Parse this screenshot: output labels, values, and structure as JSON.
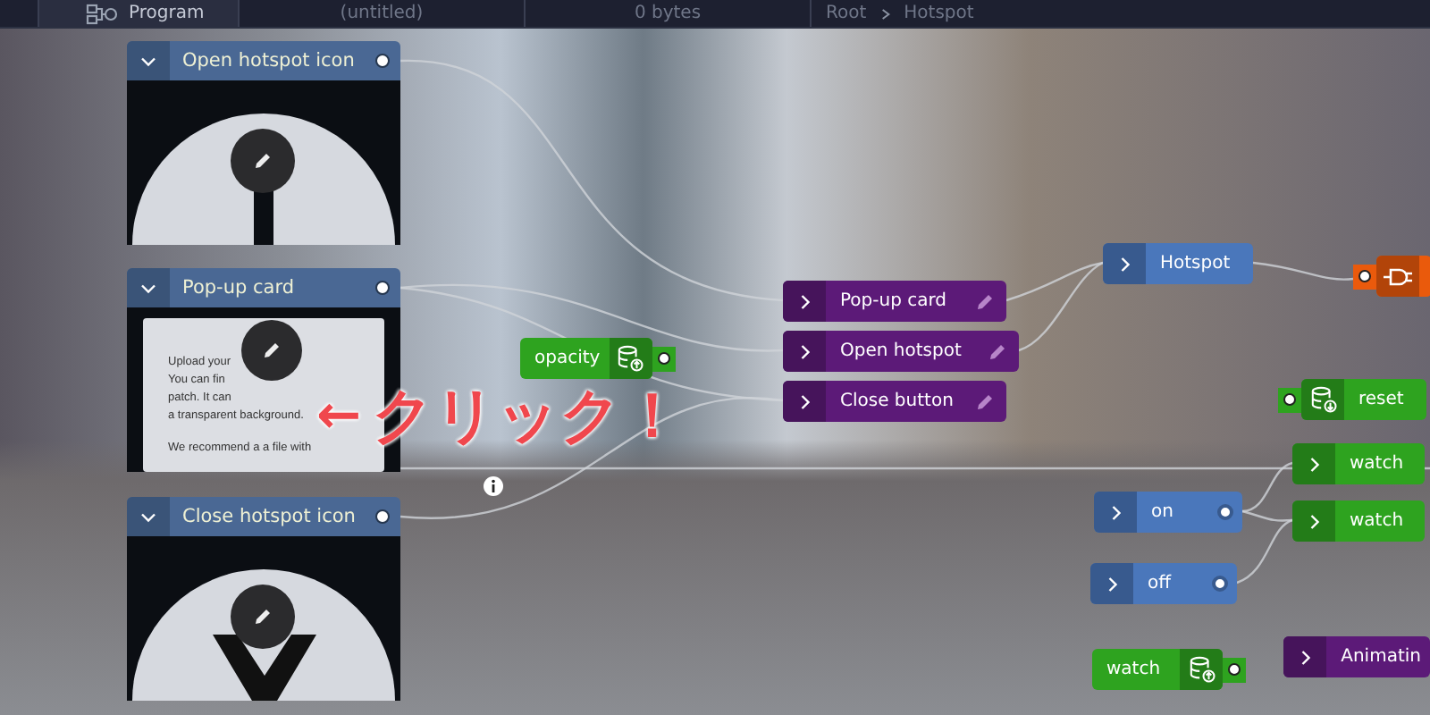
{
  "top_bar": {
    "program_label": "Program",
    "document_title": "(untitled)",
    "size": "0 bytes",
    "breadcrumb": [
      "Root",
      "Hotspot"
    ]
  },
  "image_nodes": [
    {
      "title": "Open hotspot icon",
      "kind": "open-icon"
    },
    {
      "title": "Pop-up card",
      "kind": "card",
      "card_paragraphs": [
        [
          "Upload your",
          "You can fin",
          "patch. It can",
          "a transparent background."
        ],
        [
          "We recommend a a file with"
        ]
      ]
    },
    {
      "title": "Close hotspot icon",
      "kind": "close-icon"
    }
  ],
  "nodes": [
    {
      "label": "opacity",
      "kind": "store-right",
      "color": "#2ea31f",
      "editable": false,
      "port": true
    },
    {
      "label": "Pop-up card",
      "kind": "chevron",
      "color": "#5c1a78",
      "editable": true,
      "port": false
    },
    {
      "label": "Open hotspot",
      "kind": "chevron",
      "color": "#5c1a78",
      "editable": true,
      "port": false
    },
    {
      "label": "Close button",
      "kind": "chevron",
      "color": "#5c1a78",
      "editable": true,
      "port": false
    },
    {
      "label": "Hotspot",
      "kind": "chevron",
      "color": "#4a77bb",
      "editable": false,
      "port": false
    },
    {
      "kind": "plug",
      "color": "#ea5a0c",
      "editable": false,
      "port": true
    },
    {
      "label": "reset",
      "kind": "store-left",
      "color": "#2ea31f",
      "editable": false,
      "port": true
    },
    {
      "label": "watch",
      "kind": "chevron",
      "color": "#2ea31f",
      "editable": false,
      "port": false
    },
    {
      "label": "on",
      "kind": "chevron",
      "color": "#4a77bb",
      "editable": false,
      "port": true
    },
    {
      "label": "watch",
      "kind": "chevron",
      "color": "#2ea31f",
      "editable": false,
      "port": false
    },
    {
      "label": "off",
      "kind": "chevron",
      "color": "#4a77bb",
      "editable": false,
      "port": true
    },
    {
      "label": "watch",
      "kind": "store-right",
      "color": "#2ea31f",
      "editable": false,
      "port": true
    },
    {
      "label": "Animatin",
      "kind": "chevron",
      "color": "#5c1a78",
      "editable": false,
      "port": false
    }
  ],
  "annotation": {
    "arrow": "←",
    "text": "クリック！"
  }
}
